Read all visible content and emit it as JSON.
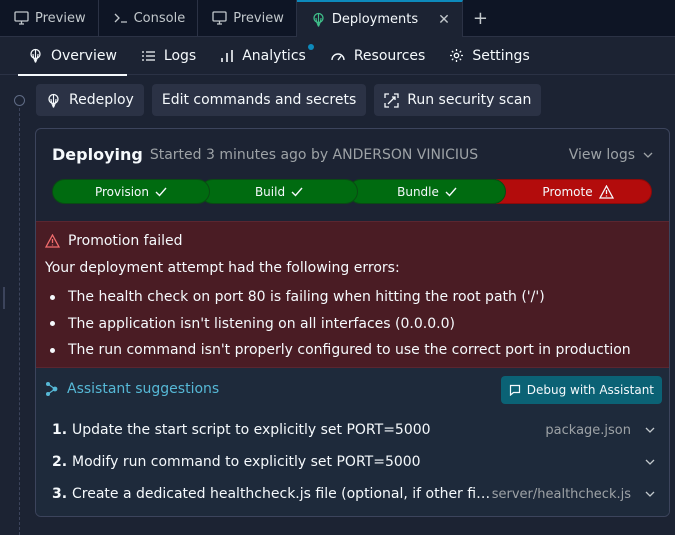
{
  "tabs": [
    {
      "label": "Preview",
      "icon": "monitor-icon"
    },
    {
      "label": "Console",
      "icon": "terminal-icon"
    },
    {
      "label": "Preview",
      "icon": "monitor-icon"
    },
    {
      "label": "Deployments",
      "icon": "deploy-icon",
      "active": true
    }
  ],
  "subnav": {
    "overview": "Overview",
    "logs": "Logs",
    "analytics": "Analytics",
    "resources": "Resources",
    "settings": "Settings"
  },
  "actions": {
    "redeploy": "Redeploy",
    "edit": "Edit commands and secrets",
    "scan": "Run security scan"
  },
  "deployment": {
    "status": "Deploying",
    "started": "Started 3 minutes ago by ANDERSON VINICIUS",
    "view_logs": "View logs",
    "stages": [
      {
        "label": "Provision",
        "state": "success"
      },
      {
        "label": "Build",
        "state": "success"
      },
      {
        "label": "Bundle",
        "state": "success"
      },
      {
        "label": "Promote",
        "state": "failed"
      }
    ]
  },
  "error": {
    "title": "Promotion failed",
    "description": "Your deployment attempt had the following errors:",
    "items": [
      "The health check on port 80 is failing when hitting the root path ('/')",
      "The application isn't listening on all interfaces (0.0.0.0)",
      "The run command isn't properly configured to use the correct port in production"
    ]
  },
  "assistant": {
    "title": "Assistant suggestions",
    "debug_label": "Debug with Assistant",
    "suggestions": [
      {
        "num": "1.",
        "text": "Update the start script to explicitly set PORT=5000",
        "file": "package.json"
      },
      {
        "num": "2.",
        "text": "Modify run command to explicitly set PORT=5000",
        "file": ""
      },
      {
        "num": "3.",
        "text": "Create a dedicated healthcheck.js file (optional, if other fixes don't...",
        "file": "server/healthcheck.js"
      }
    ]
  },
  "colors": {
    "success": "#006b10",
    "failed": "#b30c0c",
    "accent": "#0d8abc",
    "error_bg": "#4a1c24",
    "assistant": "#56b8d6"
  }
}
